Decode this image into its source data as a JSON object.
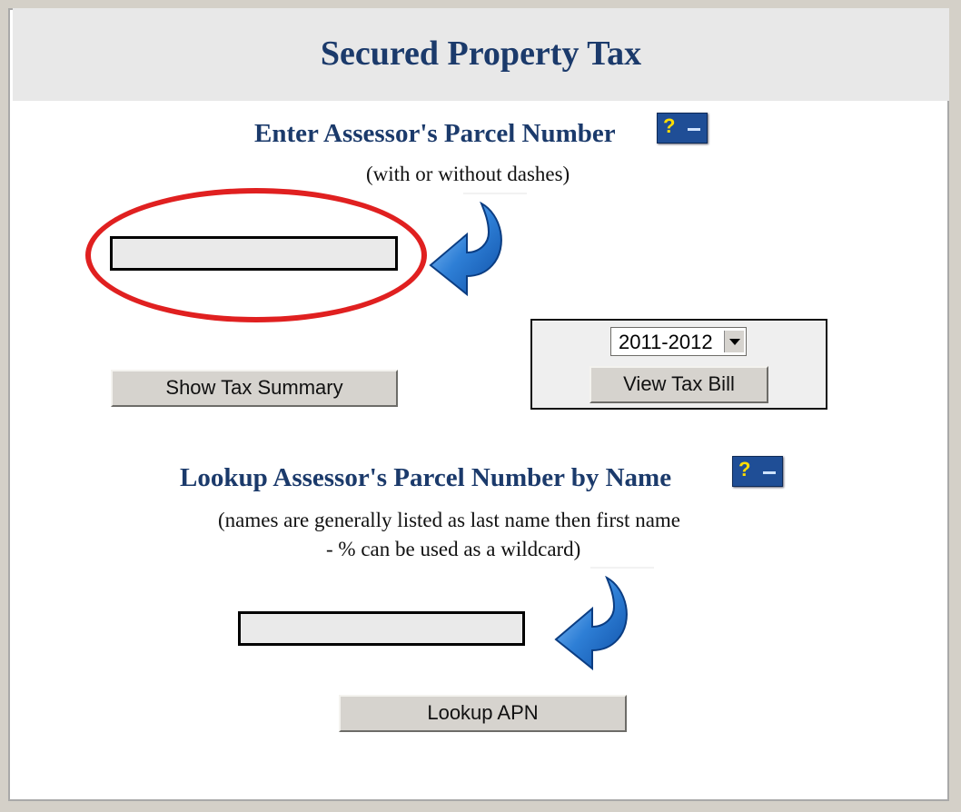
{
  "page": {
    "title": "Secured Property Tax"
  },
  "parcel_section": {
    "heading": "Enter Assessor's Parcel Number",
    "subtext": "(with or without dashes)",
    "help_icon_label": "?",
    "input_value": "",
    "show_summary_label": "Show Tax Summary",
    "tax_year_selected": "2011-2012",
    "view_bill_label": "View Tax Bill",
    "highlight_color": "#e02020"
  },
  "name_section": {
    "heading": "Lookup Assessor's Parcel Number by Name",
    "subtext_line1": "(names are generally listed as last name then first name",
    "subtext_line2": "- % can be used as a wildcard)",
    "help_icon_label": "?",
    "input_value": "",
    "lookup_label": "Lookup APN"
  },
  "colors": {
    "heading": "#1b3a6b",
    "arrow": "#2e7fd6"
  }
}
